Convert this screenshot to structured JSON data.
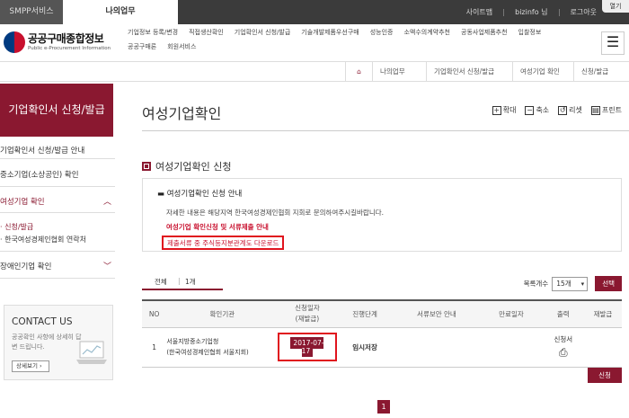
{
  "topbar": {
    "tab1": "SMPP서비스",
    "tab2": "나의업무",
    "links": [
      "사이트맵",
      "bizinfo 님",
      "로그아웃"
    ],
    "hello": "열기"
  },
  "header": {
    "logo_title": "공공구매종합정보",
    "logo_sub": "Public e-Procurement Information",
    "menu": [
      "기업정보 등록/변경",
      "직접생산확인",
      "기업확인서 신청/발급",
      "기술개발제품우선구매",
      "성능인증",
      "소액수의계약추천",
      "공동사업제품추천",
      "입찰정보",
      "공공구매론",
      "회원서비스"
    ]
  },
  "breadcrumb": {
    "items": [
      "나의업무",
      "기업확인서 신청/발급",
      "여성기업 확인",
      "신청/발급"
    ]
  },
  "sidebar": {
    "title": "기업확인서 신청/발급",
    "items": [
      "기업확인서 신청/발급 안내",
      "중소기업(소상공인) 확인",
      "여성기업 확인",
      "신청/발급",
      "한국여성경제인협회 연락처",
      "장애인기업 확인"
    ],
    "contact": {
      "title": "CONTACT US",
      "text": "공공확인 사항에 상세히 답변 드립니다.",
      "button": "상세보기"
    }
  },
  "page": {
    "title": "여성기업확인",
    "tools": [
      "확대",
      "축소",
      "리셋",
      "프린트"
    ],
    "section": "여성기업확인 신청",
    "notice": {
      "heading": "여성기업확인 신청 안내",
      "text": "자세한 내용은 해당지역 한국여성경제인협회 지회로 문의하여주시길바랍니다.",
      "link1": "여성기업 확인신청 및 서류제출 안내",
      "link2": "제출서류 중 주식등지분관계도 다운로드"
    },
    "tabs": {
      "all": "전체",
      "count": "1개"
    },
    "filter": {
      "label": "목록개수",
      "value": "15개",
      "button": "선택"
    },
    "table": {
      "headers": [
        "NO",
        "확인기관",
        "신청일자\n(재발급)",
        "진행단계",
        "서류보안 안내",
        "만료일자",
        "출력",
        "재발급"
      ],
      "rows": [
        {
          "no": "1",
          "org_line1": "서울지방중소기업청",
          "org_line2": "(한국여성경제인협회 서울지회)",
          "date": "2017-07-17",
          "stage": "임시저장",
          "notice": "",
          "expire": "",
          "print": "신청서",
          "reissue": ""
        }
      ]
    },
    "apply_button": "신청",
    "page_number": "1"
  }
}
